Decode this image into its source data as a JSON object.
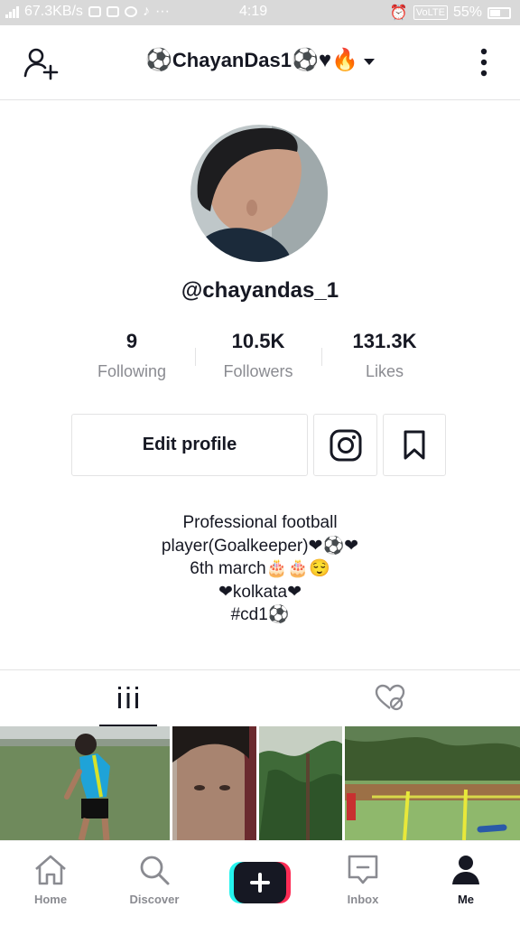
{
  "status_bar": {
    "net_speed": "67.3KB/s",
    "time": "4:19",
    "volte": "VoLTE",
    "battery": "55%",
    "battery_level": 0.55
  },
  "header": {
    "username_title": "ChayanDas1",
    "title_prefix": "⚽",
    "title_suffix": "⚽♥🔥",
    "add_user_icon": "person-add-icon",
    "menu_icon": "more-vertical-icon"
  },
  "profile": {
    "handle": "@chayandas_1",
    "stats": [
      {
        "value": "9",
        "label": "Following"
      },
      {
        "value": "10.5K",
        "label": "Followers"
      },
      {
        "value": "131.3K",
        "label": "Likes"
      }
    ],
    "edit_label": "Edit profile",
    "bio_lines": [
      "Professional football",
      "player(Goalkeeper)❤⚽❤",
      "6th march🎂🎂😌",
      "❤kolkata❤",
      "#cd1⚽"
    ]
  },
  "tabs": [
    {
      "icon": "grid-icon",
      "active": true
    },
    {
      "icon": "liked-hidden-icon",
      "active": false
    }
  ],
  "bottom_nav": [
    {
      "label": "Home",
      "icon": "home-icon"
    },
    {
      "label": "Discover",
      "icon": "search-icon"
    },
    {
      "label": "",
      "icon": "plus-icon"
    },
    {
      "label": "Inbox",
      "icon": "inbox-icon"
    },
    {
      "label": "Me",
      "icon": "person-icon",
      "active": true
    }
  ],
  "colors": {
    "text": "#161823",
    "muted": "#8a8b91",
    "divider": "#e3e3e4",
    "accent_cyan": "#25f4ee",
    "accent_red": "#fe2c55"
  }
}
